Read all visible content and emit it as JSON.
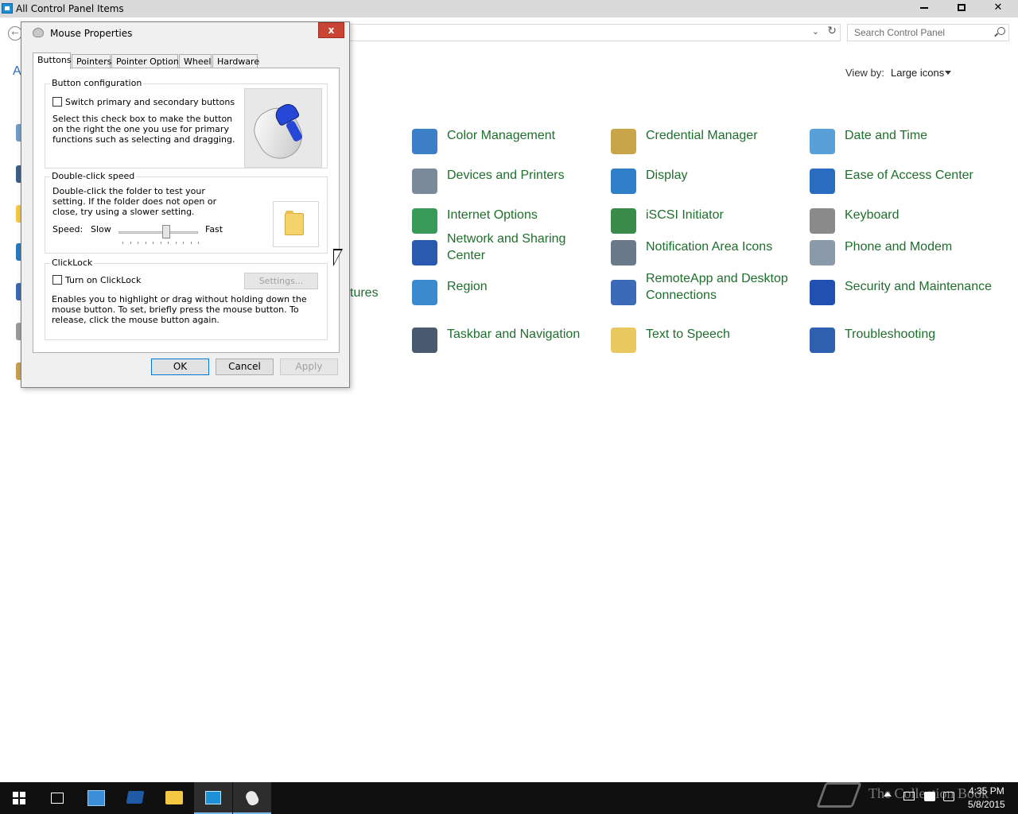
{
  "window": {
    "title": "All Control Panel Items",
    "min_label": "",
    "max_label": "",
    "close_label": "✕"
  },
  "address": {
    "back_glyph": "←",
    "chevron_glyph": "⌄",
    "refresh_glyph": "↻"
  },
  "search": {
    "placeholder": "Search Control Panel"
  },
  "view_by": {
    "label": "View by:",
    "value": "Large icons"
  },
  "peek": {
    "letter": "A",
    "tures": "tures"
  },
  "items": [
    {
      "label": "Color Management",
      "icon": "color-management-icon",
      "color": "#3d7fc6"
    },
    {
      "label": "Credential Manager",
      "icon": "credential-manager-icon",
      "color": "#c9a54a"
    },
    {
      "label": "Date and Time",
      "icon": "date-and-time-icon",
      "color": "#5aa0d8"
    },
    {
      "label": "Devices and Printers",
      "icon": "devices-and-printers-icon",
      "color": "#7a8a9a"
    },
    {
      "label": "Display",
      "icon": "display-icon",
      "color": "#2f7fc8"
    },
    {
      "label": "Ease of Access Center",
      "icon": "ease-of-access-icon",
      "color": "#2a6cc0"
    },
    {
      "label": "Internet Options",
      "icon": "internet-options-icon",
      "color": "#3a9a5a"
    },
    {
      "label": "iSCSI Initiator",
      "icon": "iscsi-initiator-icon",
      "color": "#3a8a4a"
    },
    {
      "label": "Keyboard",
      "icon": "keyboard-icon",
      "color": "#8a8a8a"
    },
    {
      "label": "Network and Sharing Center",
      "icon": "network-sharing-icon",
      "color": "#2a5ab0"
    },
    {
      "label": "Notification Area Icons",
      "icon": "notification-area-icon",
      "color": "#6a7a8a"
    },
    {
      "label": "Phone and Modem",
      "icon": "phone-and-modem-icon",
      "color": "#8a9aa8"
    },
    {
      "label": "Region",
      "icon": "region-icon",
      "color": "#3a8ad0"
    },
    {
      "label": "RemoteApp and Desktop Connections",
      "icon": "remoteapp-icon",
      "color": "#3a6ab8"
    },
    {
      "label": "Security and Maintenance",
      "icon": "security-maintenance-icon",
      "color": "#2050b0"
    },
    {
      "label": "Taskbar and Navigation",
      "icon": "taskbar-navigation-icon",
      "color": "#4a5a70"
    },
    {
      "label": "Text to Speech",
      "icon": "text-to-speech-icon",
      "color": "#e8c860"
    },
    {
      "label": "Troubleshooting",
      "icon": "troubleshooting-icon",
      "color": "#3060b0"
    }
  ],
  "dialog": {
    "title": "Mouse Properties",
    "close_label": "x",
    "tabs": [
      "Buttons",
      "Pointers",
      "Pointer Options",
      "Wheel",
      "Hardware"
    ],
    "button_config": {
      "label": "Button configuration",
      "checkbox_label": "Switch primary and secondary buttons",
      "description": "Select this check box to make the button on the right the one you use for primary functions such as selecting and dragging."
    },
    "double_click": {
      "label": "Double-click speed",
      "description": "Double-click the folder to test your setting. If the folder does not open or close, try using a slower setting.",
      "speed_label": "Speed:",
      "slow_label": "Slow",
      "fast_label": "Fast",
      "speed_value": 0.6
    },
    "clicklock": {
      "label": "ClickLock",
      "checkbox_label": "Turn on ClickLock",
      "settings_button": "Settings...",
      "description": "Enables you to highlight or drag without holding down the mouse button. To set, briefly press the mouse button. To release, click the mouse button again."
    },
    "ok_button": "OK",
    "cancel_button": "Cancel",
    "apply_button": "Apply"
  },
  "taskbar": {
    "time": "4:35 PM",
    "date": "5/8/2015",
    "watermark": "The Collection Book"
  }
}
